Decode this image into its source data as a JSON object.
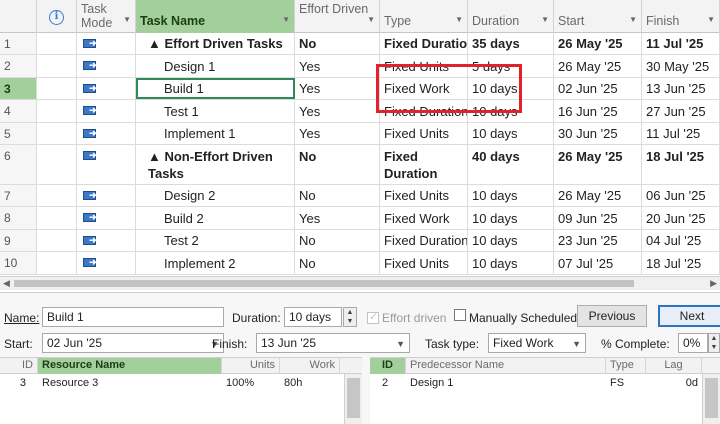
{
  "columns": {
    "info_icon_label": "i",
    "task_mode": "Task Mode",
    "task_name": "Task Name",
    "effort_driven": "Effort Driven",
    "type": "Type",
    "duration": "Duration",
    "start": "Start",
    "finish": "Finish"
  },
  "rows": [
    {
      "id": "1",
      "name": "▲ Effort Driven Tasks",
      "effort": "No",
      "type": "Fixed Duration",
      "duration": "35 days",
      "start": "26 May '25",
      "finish": "11 Jul '25",
      "summary": true
    },
    {
      "id": "2",
      "name": "Design 1",
      "effort": "Yes",
      "type": "Fixed Units",
      "duration": "5 days",
      "start": "26 May '25",
      "finish": "30 May '25"
    },
    {
      "id": "3",
      "name": "Build 1",
      "effort": "Yes",
      "type": "Fixed Work",
      "duration": "10 days",
      "start": "02 Jun '25",
      "finish": "13 Jun '25",
      "active": true
    },
    {
      "id": "4",
      "name": "Test 1",
      "effort": "Yes",
      "type": "Fixed Duration",
      "duration": "10 days",
      "start": "16 Jun '25",
      "finish": "27 Jun '25"
    },
    {
      "id": "5",
      "name": "Implement 1",
      "effort": "Yes",
      "type": "Fixed Units",
      "duration": "10 days",
      "start": "30 Jun '25",
      "finish": "11 Jul '25"
    },
    {
      "id": "6",
      "name": "▲ Non-Effort Driven Tasks",
      "effort": "No",
      "type": "Fixed Duration",
      "duration": "40 days",
      "start": "26 May '25",
      "finish": "18 Jul '25",
      "summary": true
    },
    {
      "id": "7",
      "name": "Design 2",
      "effort": "No",
      "type": "Fixed Units",
      "duration": "10 days",
      "start": "26 May '25",
      "finish": "06 Jun '25"
    },
    {
      "id": "8",
      "name": "Build 2",
      "effort": "Yes",
      "type": "Fixed Work",
      "duration": "10 days",
      "start": "09 Jun '25",
      "finish": "20 Jun '25"
    },
    {
      "id": "9",
      "name": "Test 2",
      "effort": "No",
      "type": "Fixed Duration",
      "duration": "10 days",
      "start": "23 Jun '25",
      "finish": "04 Jul '25"
    },
    {
      "id": "10",
      "name": "Implement 2",
      "effort": "No",
      "type": "Fixed Units",
      "duration": "10 days",
      "start": "07 Jul '25",
      "finish": "18 Jul '25"
    }
  ],
  "form": {
    "name_label": "Name:",
    "name_value": "Build 1",
    "duration_label": "Duration:",
    "duration_value": "10 days",
    "effort_driven_label": "Effort driven",
    "manually_scheduled_label": "Manually Scheduled",
    "previous_label": "Previous",
    "next_label": "Next",
    "start_label": "Start:",
    "start_value": "02 Jun '25",
    "finish_label": "Finish:",
    "finish_value": "13 Jun '25",
    "task_type_label": "Task type:",
    "task_type_value": "Fixed Work",
    "complete_label": "% Complete:",
    "complete_value": "0%"
  },
  "resources": {
    "headers": {
      "id": "ID",
      "name": "Resource Name",
      "units": "Units",
      "work": "Work"
    },
    "rows": [
      {
        "id": "3",
        "name": "Resource 3",
        "units": "100%",
        "work": "80h"
      }
    ]
  },
  "predecessors": {
    "headers": {
      "id": "ID",
      "name": "Predecessor Name",
      "type": "Type",
      "lag": "Lag"
    },
    "rows": [
      {
        "id": "2",
        "name": "Design 1",
        "type": "FS",
        "lag": "0d"
      }
    ]
  },
  "colors": {
    "highlight_green": "#a3cf9c",
    "annotation_red": "#e0222a",
    "icon_blue": "#3b78c5"
  },
  "icons": {
    "task_mode": "auto-scheduled-task-icon",
    "info": "info-icon"
  }
}
